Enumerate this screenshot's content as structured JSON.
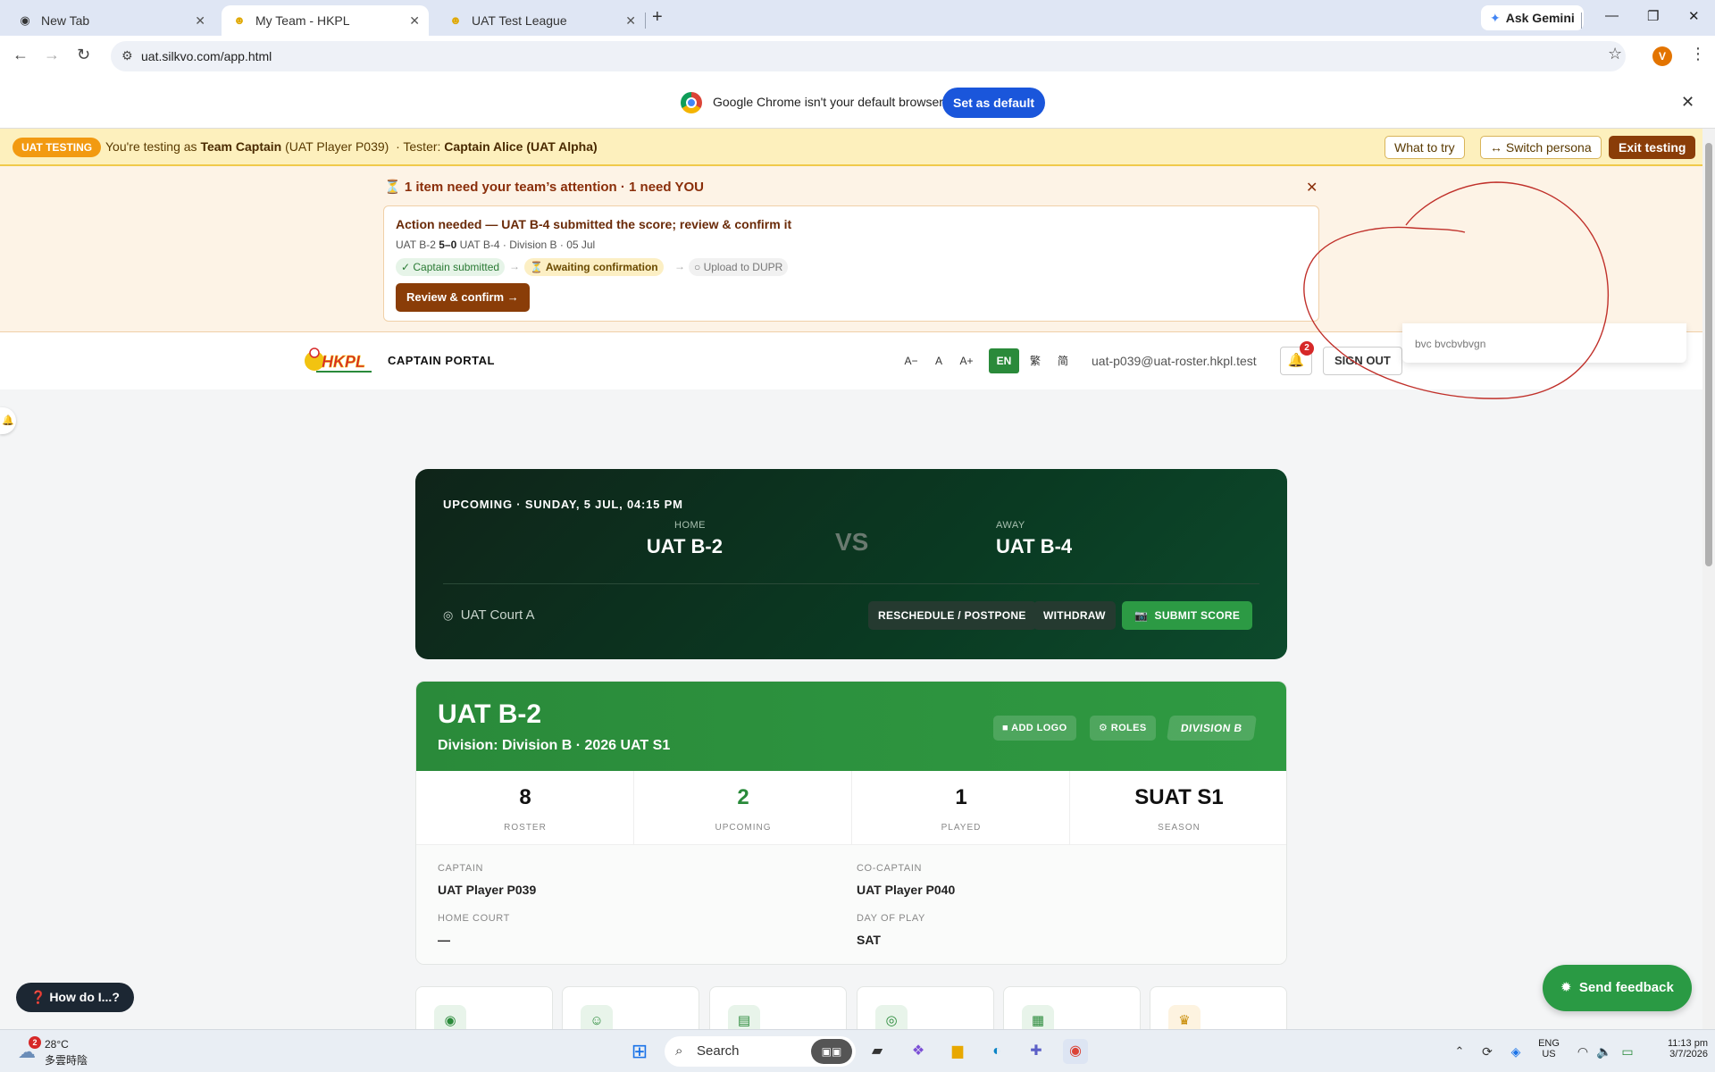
{
  "browser": {
    "tabs": [
      {
        "title": "New Tab",
        "icon": "chrome-icon"
      },
      {
        "title": "My Team - HKPL",
        "icon": "hkpl-favicon"
      },
      {
        "title": "UAT Test League",
        "icon": "hkpl-favicon"
      }
    ],
    "ask_gemini": "Ask Gemini",
    "url": "uat.silkvo.com/app.html",
    "profile_initial": "V"
  },
  "default_bar": {
    "message": "Google Chrome isn't your default browser",
    "button": "Set as default"
  },
  "uat_bar": {
    "badge": "UAT TESTING",
    "prefix": "You're testing as",
    "role": "Team Captain",
    "player": "(UAT Player P039)",
    "tester_prefix": "· Tester:",
    "tester": "Captain Alice (UAT Alpha)",
    "what_to_try": "What to try",
    "switch_persona": "↔ Switch persona",
    "exit_testing": "Exit testing"
  },
  "attention": {
    "title": "1 item need your team’s attention · 1 need YOU",
    "icon": "hourglass-icon",
    "card_title": "Action needed — UAT B-4 submitted the score; review & confirm it",
    "home": "UAT B-2",
    "score": "5–0",
    "away_meta": "UAT B-4 · Division B · 05 Jul",
    "steps": [
      "✓ Captain submitted",
      "⏳ Awaiting confirmation",
      "○ Upload to DUPR"
    ],
    "step_colors": [
      "#e6f4e8",
      "#fcefc4",
      "#f1f1f1"
    ],
    "button": "Review & confirm →"
  },
  "header": {
    "portal_title": "CAPTAIN PORTAL",
    "logo_text": "HKPL",
    "font_sizes": [
      "A−",
      "A",
      "A+"
    ],
    "languages": [
      "EN",
      "繁",
      "简"
    ],
    "active_language": "EN",
    "email": "uat-p039@uat-roster.hkpl.test",
    "notification_count": "2",
    "sign_out": "SIGN OUT",
    "notif_preview": "bvc bvcbvbvgn"
  },
  "match": {
    "upcoming": "UPCOMING · SUNDAY, 5 JUL, 04:15 PM",
    "home_label": "HOME",
    "home_team": "UAT B-2",
    "vs": "VS",
    "away_label": "AWAY",
    "away_team": "UAT B-4",
    "court": "UAT Court A",
    "reschedule": "RESCHEDULE / POSTPONE",
    "withdraw": "WITHDRAW",
    "submit_score": "SUBMIT SCORE"
  },
  "team": {
    "name": "UAT B-2",
    "division_line": "Division: Division B · 2026 UAT S1",
    "add_logo": "ADD LOGO",
    "roles": "ROLES",
    "division_badge": "DIVISION B",
    "stats": [
      {
        "value": "8",
        "label": "ROSTER"
      },
      {
        "value": "2",
        "label": "UPCOMING",
        "accent": "#2a8a3a"
      },
      {
        "value": "1",
        "label": "PLAYED"
      },
      {
        "value": "SUAT S1",
        "label": "SEASON"
      }
    ],
    "captain_label": "CAPTAIN",
    "captain": "UAT Player P039",
    "cocaptain_label": "CO-CAPTAIN",
    "cocaptain": "UAT Player P040",
    "home_court_label": "HOME COURT",
    "home_court": "—",
    "day_label": "DAY OF PLAY",
    "day": "SAT"
  },
  "floating": {
    "how_do_i": "❓ How do I...?",
    "send_feedback": "Send feedback"
  },
  "taskbar": {
    "weather_temp": "28°C",
    "weather_desc": "多雲時陰",
    "weather_badge": "2",
    "search": "Search",
    "lang_top": "ENG",
    "lang_bottom": "US",
    "time": "11:13 pm",
    "date": "3/7/2026"
  },
  "colors": {
    "brand_green": "#2a8a3a",
    "uat_yellow": "#fdf0bd",
    "action_brown": "#8a3d08"
  }
}
